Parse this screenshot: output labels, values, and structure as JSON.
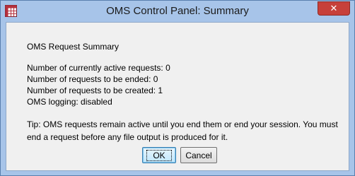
{
  "window": {
    "title": "OMS Control Panel: Summary",
    "close_glyph": "✕",
    "app_icon": "spss-grid-icon",
    "accent": "#a7c4e9",
    "close_color": "#c7403a"
  },
  "summary": {
    "heading": "OMS Request Summary",
    "active": "Number of currently active requests: 0",
    "ended": "Number of requests to be ended: 0",
    "created": "Number of requests to be created: 1",
    "logging": "OMS logging: disabled",
    "tip": "Tip: OMS requests remain active until you end them or end your session. You must end a request before any file output is produced for it."
  },
  "buttons": {
    "ok": "OK",
    "cancel": "Cancel"
  }
}
